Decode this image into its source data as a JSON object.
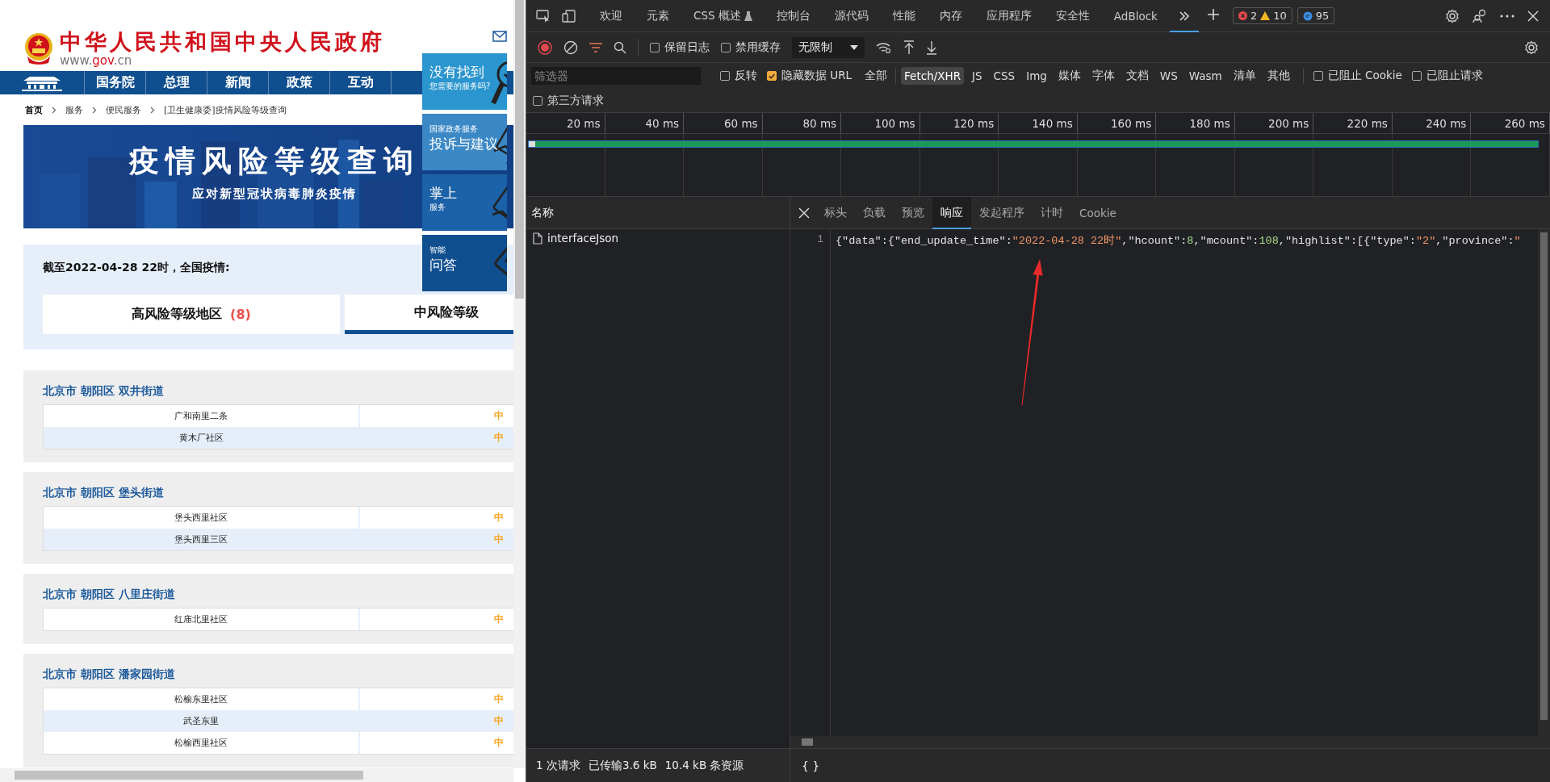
{
  "page": {
    "site_title": "中华人民共和国中央人民政府",
    "site_domain": [
      {
        "text": "www.",
        "highlight": false
      },
      {
        "text": "gov",
        "highlight": true
      },
      {
        "text": ".cn",
        "highlight": false
      }
    ],
    "nav": [
      "国务院",
      "总理",
      "新闻",
      "政策",
      "互动"
    ],
    "breadcrumb": [
      "首页",
      "服务",
      "便民服务",
      "[卫生健康委]疫情风险等级查询"
    ],
    "banner": {
      "title": "疫情风险等级查询",
      "subtitle": "应对新型冠状病毒肺炎疫情"
    },
    "float_panels": [
      {
        "lines": [
          {
            "text": "没有找到",
            "large": true
          },
          {
            "text": "您需要的服务吗?",
            "large": false
          }
        ]
      },
      {
        "lines": [
          {
            "text": "国家政务服务",
            "large": false
          },
          {
            "text": "投诉与建议",
            "large": true
          }
        ]
      },
      {
        "lines": [
          {
            "text": "掌上",
            "large": true
          },
          {
            "text": "服务",
            "large": false
          }
        ]
      },
      {
        "lines": [
          {
            "text": "智能",
            "large": false
          },
          {
            "text": "问答",
            "large": true
          }
        ]
      }
    ],
    "summary": {
      "heading": "截至2022-04-28 22时，全国疫情:",
      "tabs": [
        {
          "label": "高风险等级地区",
          "count": "(8)",
          "selected": false
        },
        {
          "label": "中风险等级",
          "selected": true
        }
      ]
    },
    "groups": [
      {
        "title": "北京市 朝阳区 双井街道",
        "rows": [
          {
            "name": "广和南里二条",
            "risk": "中"
          },
          {
            "name": "黄木厂社区",
            "risk": "中"
          }
        ]
      },
      {
        "title": "北京市 朝阳区 堡头街道",
        "rows": [
          {
            "name": "堡头西里社区",
            "risk": "中"
          },
          {
            "name": "堡头西里三区",
            "risk": "中"
          }
        ]
      },
      {
        "title": "北京市 朝阳区 八里庄街道",
        "rows": [
          {
            "name": "红庙北里社区",
            "risk": "中"
          }
        ]
      },
      {
        "title": "北京市 朝阳区 潘家园街道",
        "rows": [
          {
            "name": "松榆东里社区",
            "risk": "中"
          },
          {
            "name": "武圣东里",
            "risk": "中"
          },
          {
            "name": "松榆西里社区",
            "risk": "中"
          }
        ]
      }
    ]
  },
  "devtools": {
    "tabs": [
      {
        "label": "欢迎",
        "selected": false
      },
      {
        "label": "元素",
        "selected": false
      },
      {
        "label": "CSS 概述",
        "selected": false
      },
      {
        "label": "控制台",
        "selected": false
      },
      {
        "label": "源代码",
        "selected": false
      },
      {
        "label": "性能",
        "selected": false
      },
      {
        "label": "内存",
        "selected": false
      },
      {
        "label": "应用程序",
        "selected": false
      },
      {
        "label": "安全性",
        "selected": false
      },
      {
        "label": "AdBlock",
        "selected": false
      }
    ],
    "overflow_selected": true,
    "counts": {
      "errors": "2",
      "warnings": "10",
      "issues": "95"
    },
    "toolbar": {
      "recording": true,
      "preserve_log": {
        "label": "保留日志",
        "checked": false
      },
      "disable_cache": {
        "label": "禁用缓存",
        "checked": false
      },
      "throttle": "无限制"
    },
    "filter": {
      "placeholder": "筛选器",
      "invert": {
        "label": "反转",
        "checked": false
      },
      "hide_data_urls": {
        "label": "隐藏数据 URL",
        "checked": true
      },
      "types": [
        {
          "label": "全部",
          "selected": false
        },
        {
          "label": "Fetch/XHR",
          "selected": true
        },
        {
          "label": "JS",
          "selected": false
        },
        {
          "label": "CSS",
          "selected": false
        },
        {
          "label": "Img",
          "selected": false
        },
        {
          "label": "媒体",
          "selected": false
        },
        {
          "label": "字体",
          "selected": false
        },
        {
          "label": "文档",
          "selected": false
        },
        {
          "label": "WS",
          "selected": false
        },
        {
          "label": "Wasm",
          "selected": false
        },
        {
          "label": "清单",
          "selected": false
        },
        {
          "label": "其他",
          "selected": false
        }
      ],
      "blocked_cookies": {
        "label": "已阻止 Cookie",
        "checked": false
      },
      "blocked_requests": {
        "label": "已阻止请求",
        "checked": false
      },
      "third_party": {
        "label": "第三方请求",
        "checked": false
      }
    },
    "timeline": {
      "ticks": [
        "20 ms",
        "40 ms",
        "60 ms",
        "80 ms",
        "100 ms",
        "120 ms",
        "140 ms",
        "160 ms",
        "180 ms",
        "200 ms",
        "220 ms",
        "240 ms",
        "260 ms"
      ]
    },
    "requests": {
      "column": "名称",
      "rows": [
        "interfaceJson"
      ]
    },
    "detail": {
      "tabs": [
        {
          "label": "标头",
          "selected": false
        },
        {
          "label": "负载",
          "selected": false
        },
        {
          "label": "预览",
          "selected": false
        },
        {
          "label": "响应",
          "selected": true
        },
        {
          "label": "发起程序",
          "selected": false
        },
        {
          "label": "计时",
          "selected": false
        },
        {
          "label": "Cookie",
          "selected": false
        }
      ],
      "line_numbers": [
        "1"
      ],
      "tokens": [
        {
          "kind": "punct",
          "text": "{"
        },
        {
          "kind": "key",
          "text": "\"data\""
        },
        {
          "kind": "punct",
          "text": ":{"
        },
        {
          "kind": "key",
          "text": "\"end_update_time\""
        },
        {
          "kind": "punct",
          "text": ":"
        },
        {
          "kind": "str",
          "text": "\"2022-04-28 22时\""
        },
        {
          "kind": "punct",
          "text": ","
        },
        {
          "kind": "key",
          "text": "\"hcount\""
        },
        {
          "kind": "punct",
          "text": ":"
        },
        {
          "kind": "num",
          "text": "8"
        },
        {
          "kind": "punct",
          "text": ","
        },
        {
          "kind": "key",
          "text": "\"mcount\""
        },
        {
          "kind": "punct",
          "text": ":"
        },
        {
          "kind": "num",
          "text": "108"
        },
        {
          "kind": "punct",
          "text": ","
        },
        {
          "kind": "key",
          "text": "\"highlist\""
        },
        {
          "kind": "punct",
          "text": ":[{"
        },
        {
          "kind": "key",
          "text": "\"type\""
        },
        {
          "kind": "punct",
          "text": ":"
        },
        {
          "kind": "str",
          "text": "\"2\""
        },
        {
          "kind": "punct",
          "text": ","
        },
        {
          "kind": "key",
          "text": "\"province\""
        },
        {
          "kind": "punct",
          "text": ":"
        },
        {
          "kind": "str",
          "text": "\""
        }
      ]
    },
    "status": [
      "1 次请求",
      "已传输3.6 kB",
      "10.4 kB 条资源"
    ],
    "pretty_print": "{ }"
  },
  "annotation": {
    "kind": "arrow"
  }
}
